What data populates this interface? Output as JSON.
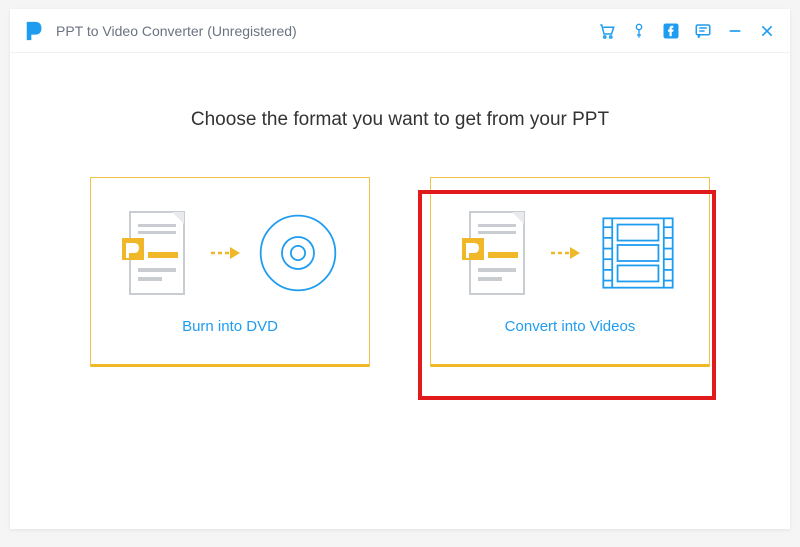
{
  "app": {
    "title": "PPT to Video Converter (Unregistered)"
  },
  "heading": "Choose the format you want to get from your PPT",
  "options": {
    "dvd": {
      "label": "Burn into DVD"
    },
    "video": {
      "label": "Convert into Videos"
    }
  },
  "colors": {
    "accent_blue": "#1e9cf0",
    "accent_yellow": "#f0b828",
    "highlight_red": "#e11b1b"
  }
}
